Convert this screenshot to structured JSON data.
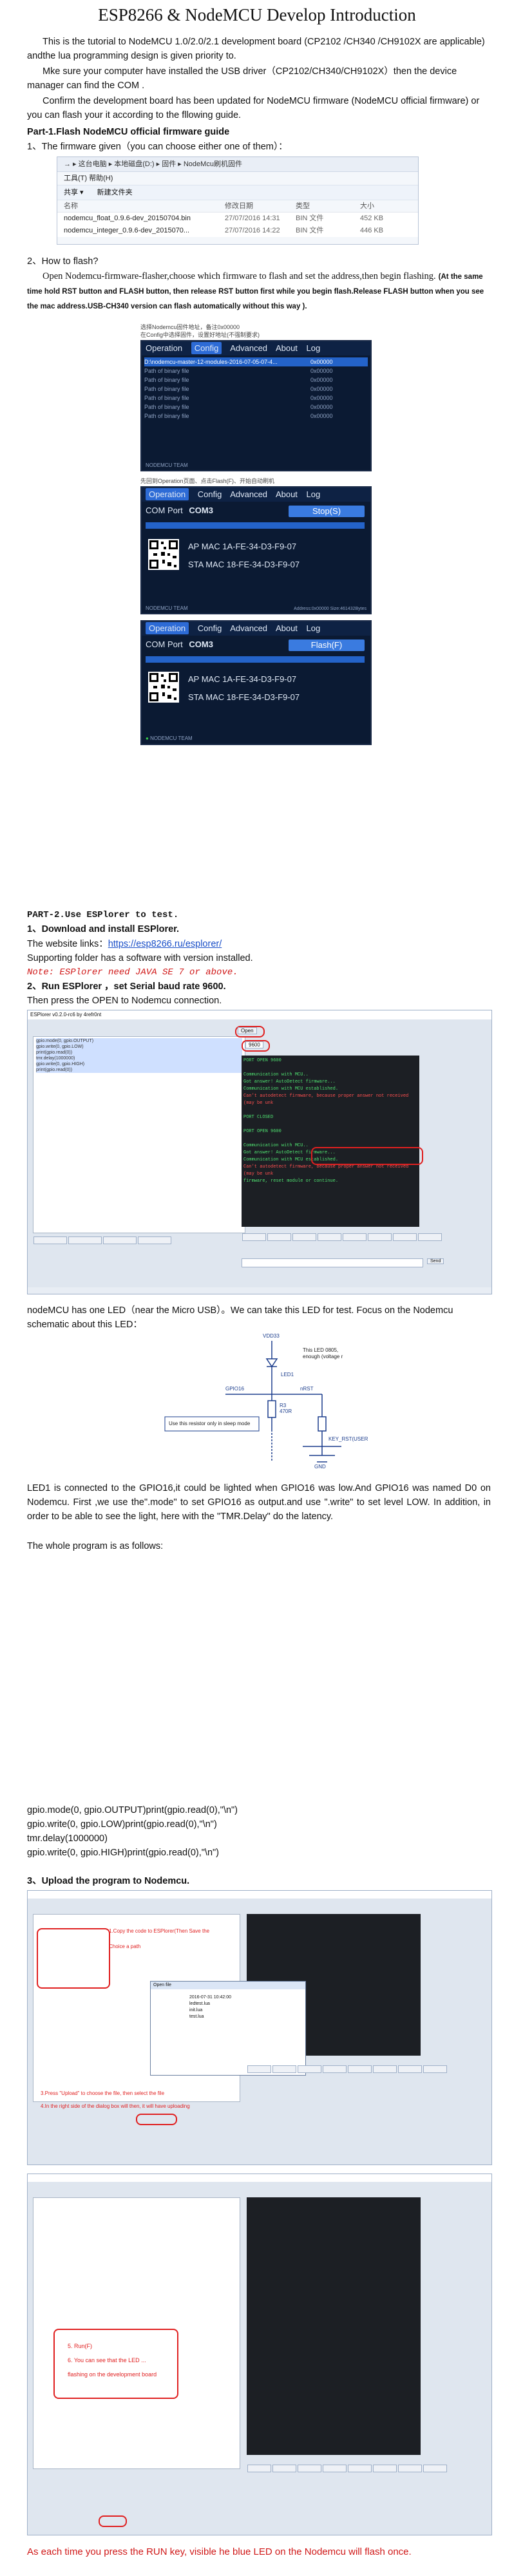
{
  "title": "ESP8266 & NodeMCU Develop Introduction",
  "intro": {
    "p1": "This is the tutorial to NodeMCU 1.0/2.0/2.1 development board (CP2102 /CH340 /CH9102X are applicable) andthe lua programming design is given priority to.",
    "p2": "Mke sure your computer have installed the USB driver（CP2102/CH340/CH9102X）then the device manager can find the COM .",
    "p3": "Confirm the development board has been updated for NodeMCU firmware (NodeMCU official firmware) or you can flash your it according to the fllowing guide."
  },
  "part1": {
    "heading": "Part-1.Flash NodeMCU official firmware guide",
    "step1": "1、The firmware given（you can choose either one of them）：",
    "explorer": {
      "address": "→ ▸ 这台电脑 ▸ 本地磁盘(D:) ▸ 固件 ▸ NodeMcu刷机固件",
      "menu": "工具(T)   帮助(H)",
      "toolbar": [
        "共享 ▾",
        "新建文件夹"
      ],
      "headers": [
        "名称",
        "修改日期",
        "类型",
        "大小"
      ],
      "files": [
        {
          "name": "nodemcu_float_0.9.6-dev_20150704.bin",
          "date": "27/07/2016 14:31",
          "type": "BIN 文件",
          "size": "452 KB"
        },
        {
          "name": "nodemcu_integer_0.9.6-dev_2015070...",
          "date": "27/07/2016 14:22",
          "type": "BIN 文件",
          "size": "446 KB"
        }
      ]
    },
    "step2": "2、How to flash?",
    "step2_text": "Open Nodemcu-firmware-flasher,choose which firmware to flash and set the address,then begin flashing.",
    "step2_bold": "(At the same time hold RST button and FLASH button, then release RST button first while you begin flash.Release FLASH button when you see the mac address.USB-CH340 version can flash automatically without this way ).",
    "flasher1": {
      "note": "选择Nodemcu固件地址，备注0x00000\n在Config中选择固件，设置好地址(不强制要求)",
      "tabs": [
        "Operation",
        "Config",
        "Advanced",
        "About",
        "Log"
      ],
      "active_tab": "Config",
      "rows": [
        "D:\\nodemcu-master-12-modules-2016-07-05-07-4...",
        "Path of binary file",
        "Path of binary file",
        "Path of binary file",
        "Path of binary file",
        "Path of binary file",
        "Path of binary file"
      ],
      "addrs": [
        "0x00000",
        "0x00000",
        "0x00000",
        "0x00000",
        "0x00000",
        "0x00000",
        "0x00000"
      ],
      "footer": "NODEMCU TEAM"
    },
    "flasher_note": "先回到Operation页面、点击Flash(F)、开始自动刷机",
    "flasher2": {
      "tabs": [
        "Operation",
        "Config",
        "Advanced",
        "About",
        "Log"
      ],
      "active_tab": "Operation",
      "com_label": "COM Port",
      "com_value": "COM3",
      "button": "Stop(S)",
      "ap_mac": "AP MAC 1A-FE-34-D3-F9-07",
      "sta_mac": "STA MAC 18-FE-34-D3-F9-07",
      "footer_left": "NODEMCU TEAM",
      "footer_right": "Address:0x00000 Size:461432Bytes"
    },
    "flasher3": {
      "tabs": [
        "Operation",
        "Config",
        "Advanced",
        "About",
        "Log"
      ],
      "active_tab": "Operation",
      "com_label": "COM Port",
      "com_value": "COM3",
      "button": "Flash(F)",
      "ap_mac": "AP MAC 1A-FE-34-D3-F9-07",
      "sta_mac": "STA MAC 18-FE-34-D3-F9-07",
      "footer_left": "NODEMCU TEAM"
    }
  },
  "part2": {
    "heading": "PART-2.Use ESPlorer to test.",
    "step1": "1、Download and install ESPlorer.",
    "website_label": "The website links：",
    "website_url": "https://esp8266.ru/esplorer/",
    "support": "Supporting folder has a software with version installed.",
    "note": "Note: ESPlorer need JAVA SE 7 or above.",
    "step2": "2、Run ESPlorer ，set Serial baud rate 9600.",
    "open": "Then press the OPEN to Nodemcu connection.",
    "esplorer1": {
      "title": "ESPlorer v0.2.0-rc6 by 4refr0nt",
      "code_lines": [
        "gpio.mode(0, gpio.OUTPUT)",
        "gpio.write(0, gpio.LOW)",
        "print(gpio.read(0))",
        "tmr.delay(1000000)",
        "gpio.write(0, gpio.HIGH)",
        "print(gpio.read(0))"
      ],
      "term_lines": [
        "PORT OPEN 9600",
        "",
        "Communication with MCU..",
        "Got answer! AutoDetect firmware...",
        "Communication with MCU established.",
        "Can't autodetect firmware, because proper answer not received (may be unk",
        "",
        "PORT CLOSED",
        "",
        "PORT OPEN 9600",
        "",
        "Communication with MCU..",
        "Got answer! AutoDetect firmware...",
        "Communication with MCU established.",
        "Can't autodetect firmware, because proper answer not received (may be unk",
        "firmware, reset module or continue."
      ],
      "open_btn": "Open",
      "baud": "9600",
      "send_btn": "Send"
    },
    "led_text": "nodeMCU has one LED（near the Micro USB）。We can take this LED for test. Focus on the Nodemcu schematic about this LED：",
    "schematic": {
      "vdd": "VDD33",
      "note": "This LED 0805,\nenough (voltage r",
      "led": "LED1",
      "gpio": "GPIO16",
      "xrst": "nRST",
      "r": "R3\n470R",
      "box": "Use this resistor only in sleep mode",
      "key": "KEY_RST(USER",
      "gnd": "GND"
    },
    "explain": "LED1 is connected to the GPIO16,it could be lighted when GPIO16 was low.And GPIO16 was named D0 on Nodemcu. First ,we use the\".mode\" to set GPIO16 as output.and use \".write\" to set level LOW. In addition, in order to be able to see the light, here with the \"TMR.Delay\" do the latency.",
    "whole": "The whole program is as follows:",
    "code": [
      "gpio.mode(0, gpio.OUTPUT)print(gpio.read(0),\"\\n\")",
      "gpio.write(0, gpio.LOW)print(gpio.read(0),\"\\n\")",
      "tmr.delay(1000000)",
      "gpio.write(0, gpio.HIGH)print(gpio.read(0),\"\\n\")"
    ],
    "step3": "3、Upload the program to Nodemcu.",
    "esplorer2": {
      "ann1": "1.Copy the code to ESPlorer(Then Save the",
      "ann2": "Choice a path",
      "ann3": "3.Press \"Upload\" to choose the file, then select the file",
      "ann4": "4.In the right side of the dialog box will then, it will have uploading",
      "dialog_title": "Open file",
      "dialog_files": [
        "2016-07-31 10:42:00",
        "ledtest.lua",
        "init.lua",
        "test.lua"
      ]
    },
    "esplorer3": {
      "ann1": "5. Run(F)",
      "ann2": "6. You can see that the LED ...",
      "ann3": "flashing on the development board"
    },
    "footer": "As each time you press the RUN key, visible he blue LED on the Nodemcu will flash once."
  },
  "colors": {
    "link": "#1a4fc8",
    "note_red": "#d01818",
    "flasher_bg": "#0b1a33",
    "flasher_accent": "#2463c9",
    "annotation_red": "#e02020"
  }
}
